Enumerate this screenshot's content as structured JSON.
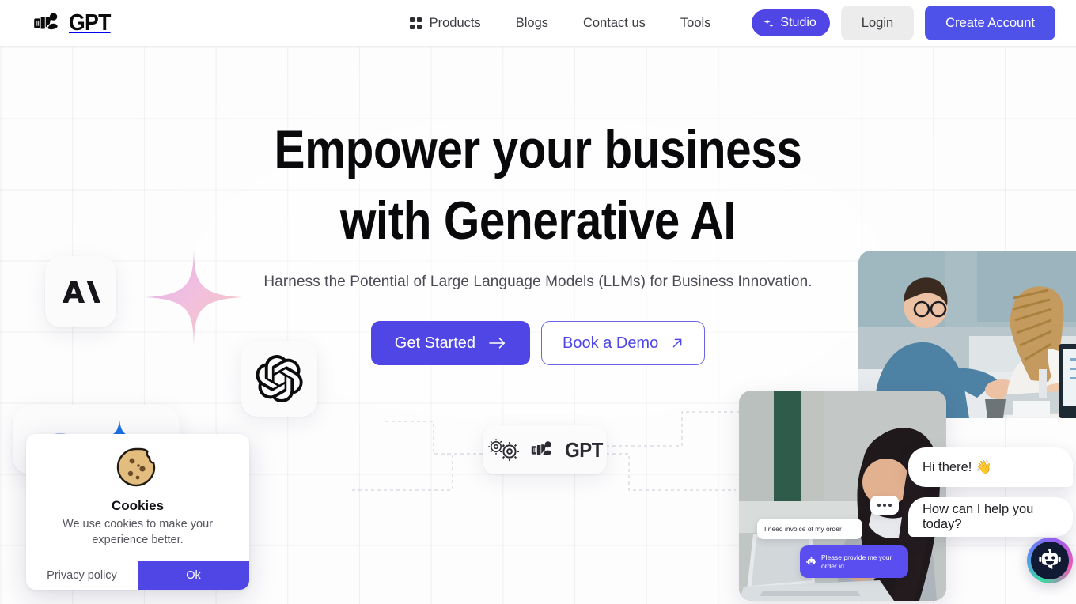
{
  "brand": {
    "name": "GPT",
    "logo_icon": "gpt-hand-logo-icon"
  },
  "nav": {
    "items": [
      {
        "label": "Products",
        "icon": "grid-icon"
      },
      {
        "label": "Blogs",
        "icon": ""
      },
      {
        "label": "Contact us",
        "icon": ""
      },
      {
        "label": "Tools",
        "icon": ""
      }
    ],
    "studio_label": "Studio",
    "studio_icon": "sparkles-icon",
    "login_label": "Login",
    "create_account_label": "Create Account"
  },
  "hero": {
    "headline_line1": "Empower your business",
    "headline_line2": "with Generative AI",
    "subtitle": "Harness the Potential of Large Language Models (LLMs) for Business Innovation.",
    "primary_cta": "Get Started",
    "primary_cta_icon": "arrow-right-icon",
    "secondary_cta": "Book a Demo",
    "secondary_cta_icon": "arrow-up-right-icon"
  },
  "cards": {
    "anthropic_icon": "anthropic-logo-icon",
    "openai_icon": "openai-logo-icon",
    "gemini_icon": "gemini-sparkle-icon",
    "gpt_card_text": "GPT",
    "gpt_card_icon": "gears-icon"
  },
  "decor": {
    "sparkle_icon": "four-point-star-sparkle-icon"
  },
  "photos": {
    "top_alt": "Two colleagues collaborating at a desk with a laptop",
    "bottom_alt": "Woman working on a laptop outdoors"
  },
  "chat": {
    "greeting": "Hi there! 👋",
    "prompt": "How can I help you today?",
    "user_message": "I need invoice of my order",
    "bot_message": "Please provide me your order id",
    "bot_icon": "robot-icon",
    "typing_icon": "typing-dots-icon",
    "widget_icon": "robot-chat-widget-icon"
  },
  "cookies": {
    "icon": "cookie-icon",
    "title": "Cookies",
    "text": "We use cookies to make your experience better.",
    "privacy_label": "Privacy policy",
    "ok_label": "Ok"
  },
  "colors": {
    "accent": "#4f46e5",
    "accent_alt": "#5b4ef0",
    "create_account": "#4f52e8",
    "login_bg": "#ececec",
    "text": "#09090b",
    "muted": "#55555f",
    "sparkle_pink": "#e9a8cf"
  }
}
